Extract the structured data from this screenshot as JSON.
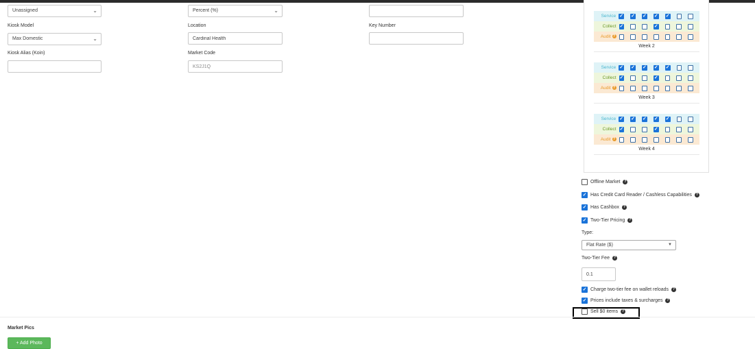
{
  "form": {
    "row1": {
      "status_select_value": "Unassigned",
      "fee_type_select_value": "Percent (%)",
      "blank_input_value": ""
    },
    "kiosk_model": {
      "label": "Kiosk Model",
      "value": "Max Domestic"
    },
    "location": {
      "label": "Location",
      "value": "Cardinal Health"
    },
    "key_number": {
      "label": "Key Number",
      "value": ""
    },
    "kiosk_alias": {
      "label": "Kiosk Alias (Koin)",
      "value": ""
    },
    "market_code": {
      "label": "Market Code",
      "placeholder": "KS2J1Q"
    }
  },
  "schedule": {
    "row_labels": {
      "service": "Service",
      "collect": "Collect",
      "audit": "Audit"
    },
    "weeks": [
      {
        "title": "Week 2",
        "service": [
          true,
          true,
          true,
          true,
          true,
          false,
          false
        ],
        "collect": [
          true,
          false,
          false,
          true,
          false,
          false,
          false
        ],
        "audit": [
          false,
          false,
          false,
          false,
          false,
          false,
          false
        ]
      },
      {
        "title": "Week 3",
        "service": [
          true,
          true,
          true,
          true,
          true,
          false,
          false
        ],
        "collect": [
          true,
          false,
          false,
          true,
          false,
          false,
          false
        ],
        "audit": [
          false,
          false,
          false,
          false,
          false,
          false,
          false
        ]
      },
      {
        "title": "Week 4",
        "service": [
          true,
          true,
          true,
          true,
          true,
          false,
          false
        ],
        "collect": [
          true,
          false,
          false,
          true,
          false,
          false,
          false
        ],
        "audit": [
          false,
          false,
          false,
          false,
          false,
          false,
          false
        ]
      }
    ]
  },
  "options": {
    "offline_market": {
      "label": "Offline Market",
      "checked": false
    },
    "credit_card_reader": {
      "label": "Has Credit Card Reader / Cashless Capabilities",
      "checked": true
    },
    "has_cashbox": {
      "label": "Has Cashbox",
      "checked": true
    },
    "two_tier_pricing": {
      "label": "Two-Tier Pricing",
      "checked": true
    },
    "type_label": "Type:",
    "type_value": "Flat Rate ($)",
    "two_tier_fee_label": "Two-Tier Fee",
    "two_tier_fee_value": "0.1",
    "charge_on_reloads": {
      "label": "Charge two-tier fee on wallet reloads",
      "checked": true
    },
    "prices_include_taxes": {
      "label": "Prices include taxes & surcharges",
      "checked": true
    },
    "sell_zero_items": {
      "label": "Sell $0 items",
      "checked": false
    }
  },
  "market_pics": {
    "title": "Market Pics",
    "add_photo_label": "+ Add Photo"
  },
  "colors": {
    "checkbox_checked": "#1a73d9",
    "service_bg": "#dff3f7",
    "collect_bg": "#eef6dc",
    "audit_bg": "#fbe9d3",
    "add_button": "#5cb85c"
  },
  "icons": {
    "help": "question-circle-icon",
    "dropdown": "chevron-down-icon",
    "check": "check-icon"
  }
}
